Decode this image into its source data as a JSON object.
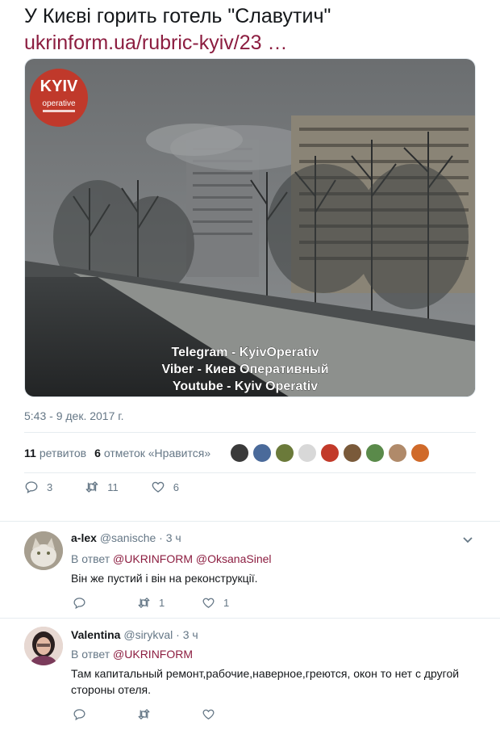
{
  "tweet": {
    "title": "У Києві горить готель \"Славутич\"",
    "link_text": "ukrinform.ua/rubric-kyiv/23 …",
    "timestamp": "5:43 - 9 дек. 2017 г.",
    "media": {
      "logo_top": "KYIV",
      "logo_bottom": "operative",
      "overlay_lines": [
        "Telegram - KyivOperativ",
        "Viber - Киев Оперативный",
        "Youtube - Kyiv Operativ"
      ]
    },
    "stats": {
      "retweets_count": "11",
      "retweets_label": "ретвитов",
      "likes_count": "6",
      "likes_label": "отметок «Нравится»"
    },
    "actions": {
      "replies": "3",
      "retweets": "11",
      "likes": "6"
    }
  },
  "replies": [
    {
      "name": "a-lex",
      "handle": "@sanische",
      "time": "· 3 ч",
      "replying_prefix": "В ответ",
      "mentions": [
        "@UKRINFORM",
        "@OksanaSinel"
      ],
      "text": "Він же пустий і він на реконструкції.",
      "actions": {
        "replies": "",
        "retweets": "1",
        "likes": "1"
      }
    },
    {
      "name": "Valentina",
      "handle": "@sirykval",
      "time": "· 3 ч",
      "replying_prefix": "В ответ",
      "mentions": [
        "@UKRINFORM"
      ],
      "text": "Там капитальный ремонт,рабочие,наверное,греются, окон то нет с другой стороны отеля.",
      "actions": {
        "replies": "",
        "retweets": "",
        "likes": ""
      }
    }
  ],
  "colors": {
    "link": "#8c1d40",
    "muted": "#657786",
    "divider": "#e6ecf0",
    "logo_red": "#c0392b"
  }
}
